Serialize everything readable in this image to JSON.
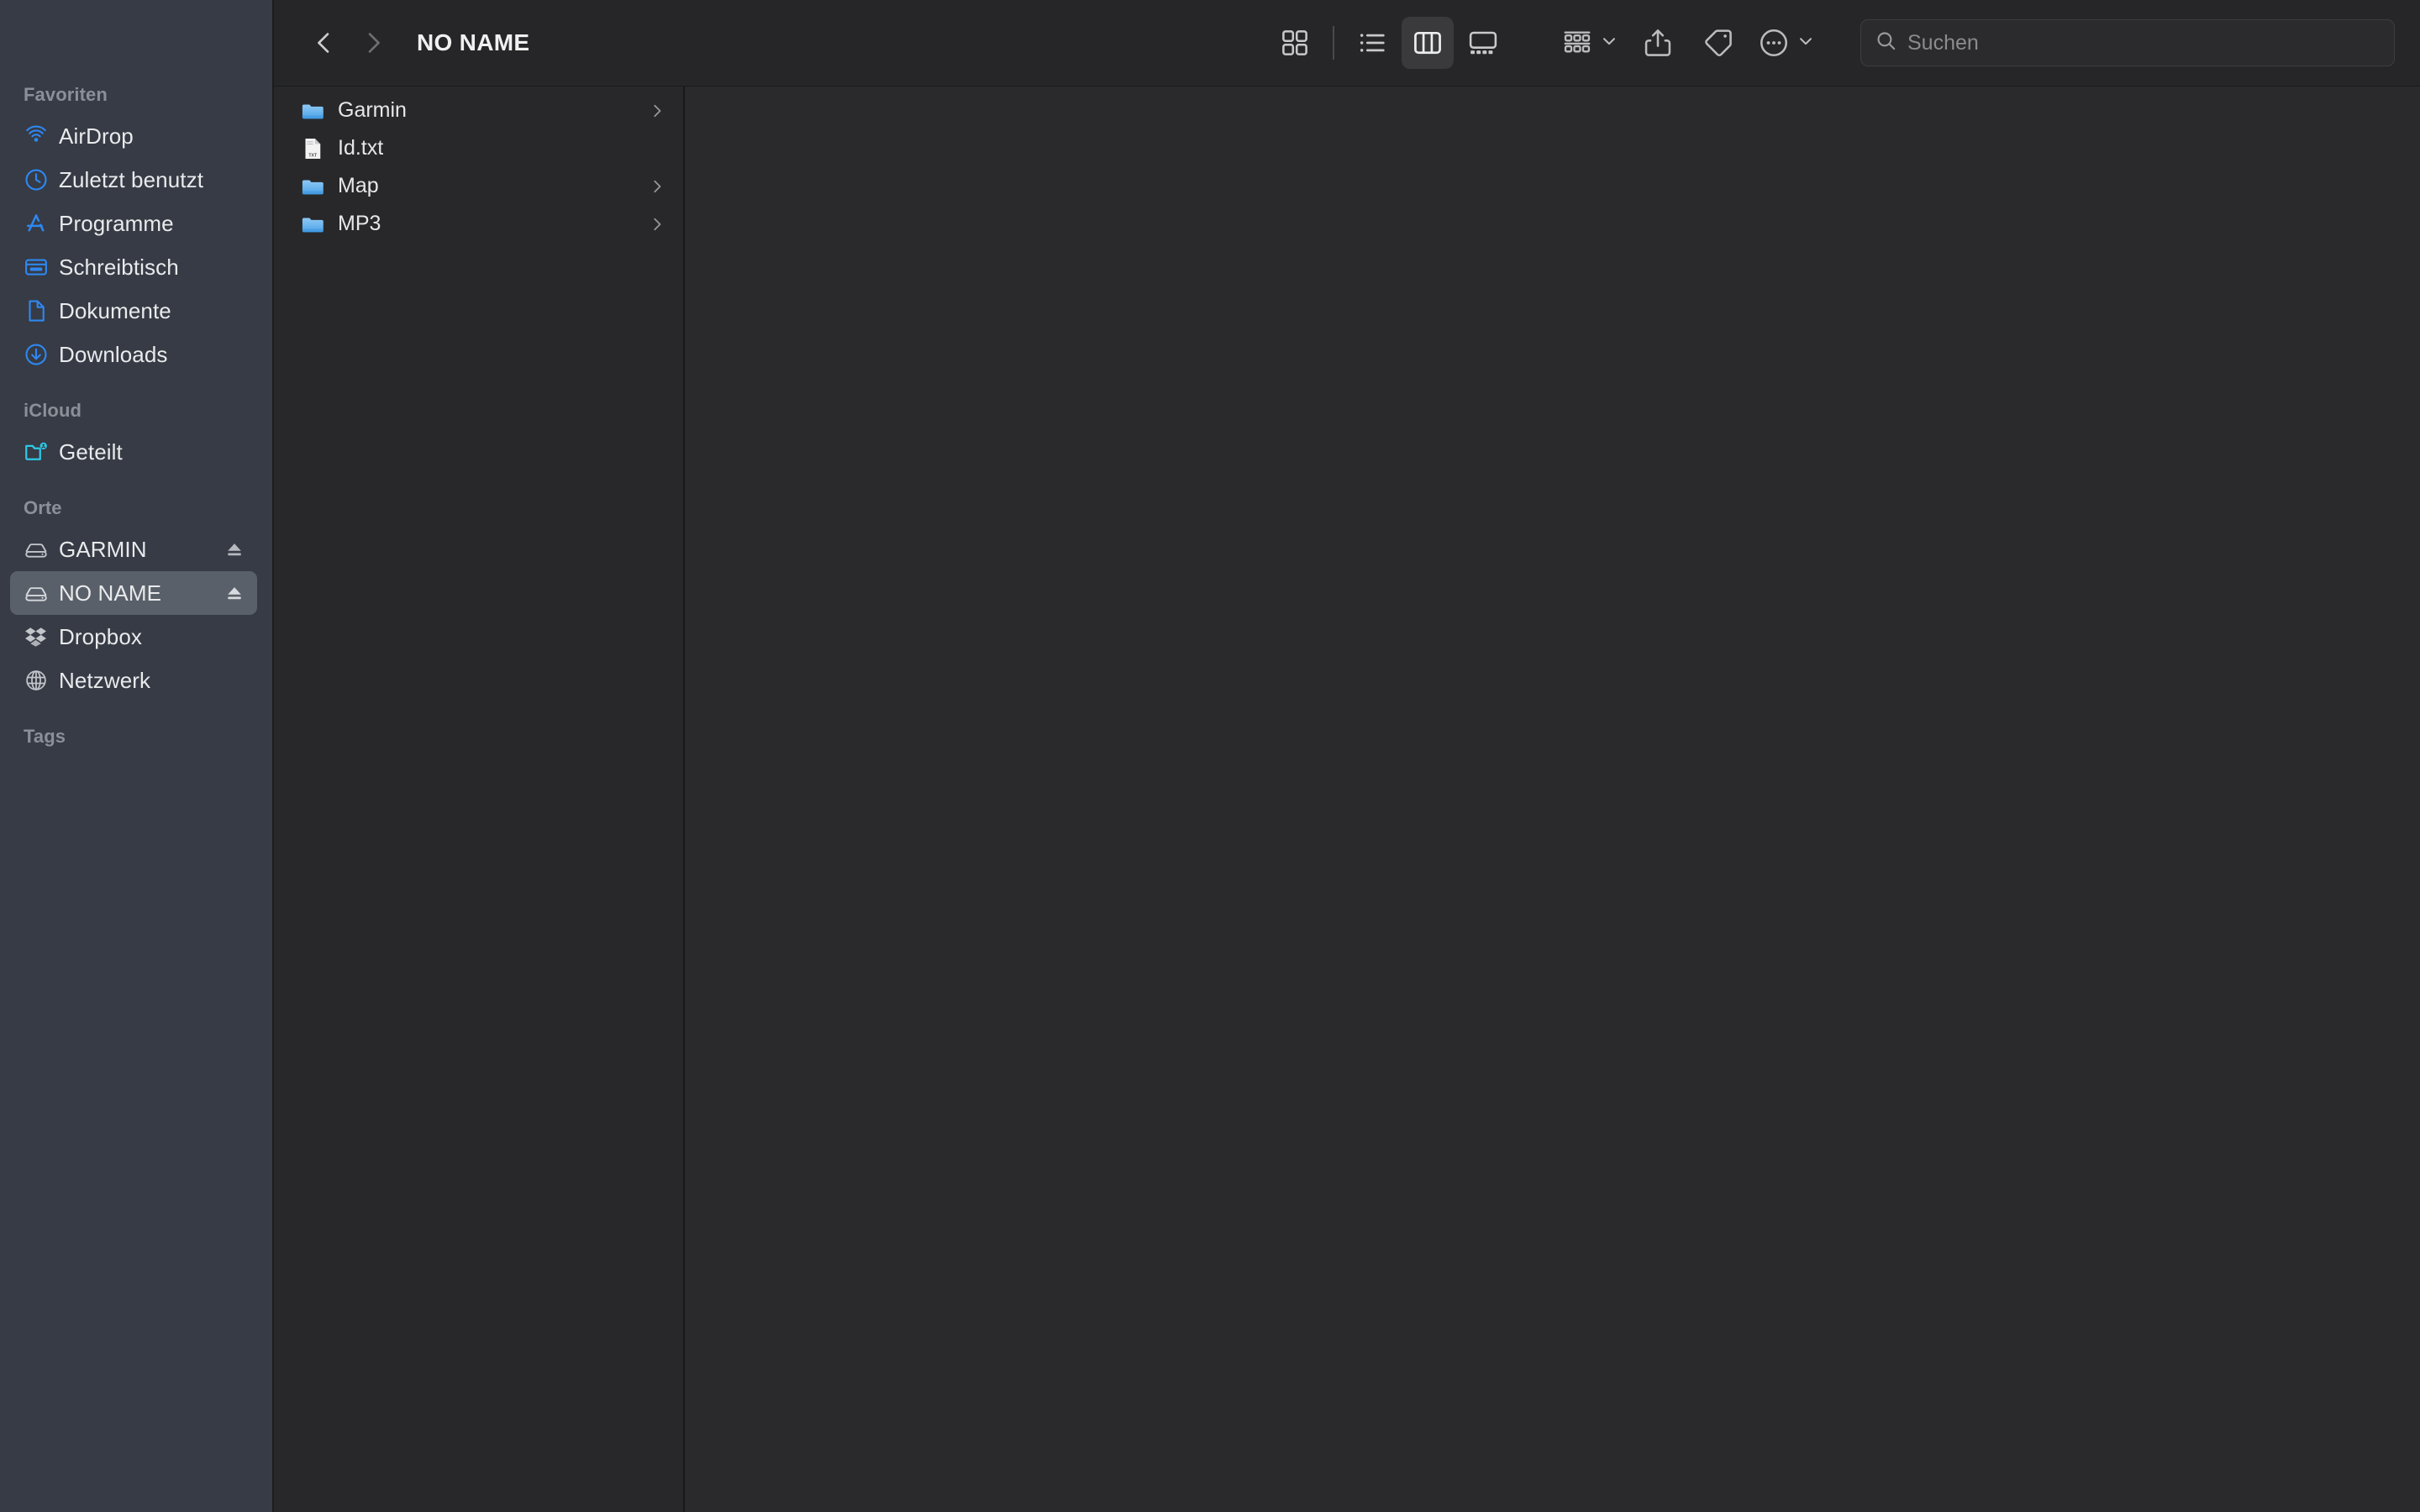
{
  "window": {
    "title": "NO NAME",
    "theme": "dark",
    "colors": {
      "sidebar_bg": "#363b45",
      "content_bg": "#28282a",
      "toolbar_bg": "#262628",
      "selection_bg": "#5a6069",
      "accent_blue": "#2f87f0",
      "folder_blue": "#6cb6ef",
      "icloud_cyan": "#2ec8e6",
      "text_primary": "#e9eaec",
      "text_secondary": "#8b8f97"
    }
  },
  "toolbar": {
    "back_label": "Zurück",
    "back_icon": "chevron-left-icon",
    "back_enabled": true,
    "forward_label": "Vorwärts",
    "forward_icon": "chevron-right-icon",
    "forward_enabled": false,
    "view_modes": [
      {
        "id": "icon",
        "label": "Symbole",
        "icon": "grid-view-icon",
        "active": false
      },
      {
        "id": "list",
        "label": "Liste",
        "icon": "list-view-icon",
        "active": false
      },
      {
        "id": "column",
        "label": "Spalten",
        "icon": "column-view-icon",
        "active": true
      },
      {
        "id": "gallery",
        "label": "Galerie",
        "icon": "gallery-view-icon",
        "active": false
      }
    ],
    "actions": [
      {
        "id": "group",
        "label": "Gruppieren",
        "icon": "group-by-icon",
        "has_chevron": true
      },
      {
        "id": "share",
        "label": "Teilen",
        "icon": "share-icon",
        "has_chevron": false
      },
      {
        "id": "tags",
        "label": "Tags",
        "icon": "tag-icon",
        "has_chevron": false
      },
      {
        "id": "more",
        "label": "Mehr",
        "icon": "ellipsis-circle-icon",
        "has_chevron": true
      }
    ]
  },
  "search": {
    "placeholder": "Suchen",
    "value": "",
    "icon": "search-icon"
  },
  "sidebar": {
    "groups": [
      {
        "title": "Favoriten",
        "items": [
          {
            "label": "AirDrop",
            "icon": "airdrop-icon",
            "selected": false,
            "ejectable": false
          },
          {
            "label": "Zuletzt benutzt",
            "icon": "clock-icon",
            "selected": false,
            "ejectable": false
          },
          {
            "label": "Programme",
            "icon": "applications-icon",
            "selected": false,
            "ejectable": false
          },
          {
            "label": "Schreibtisch",
            "icon": "desktop-icon",
            "selected": false,
            "ejectable": false
          },
          {
            "label": "Dokumente",
            "icon": "document-icon",
            "selected": false,
            "ejectable": false
          },
          {
            "label": "Downloads",
            "icon": "downloads-icon",
            "selected": false,
            "ejectable": false
          }
        ]
      },
      {
        "title": "iCloud",
        "items": [
          {
            "label": "Geteilt",
            "icon": "shared-folder-icon",
            "selected": false,
            "ejectable": false
          }
        ]
      },
      {
        "title": "Orte",
        "items": [
          {
            "label": "GARMIN",
            "icon": "external-drive-icon",
            "selected": false,
            "ejectable": true
          },
          {
            "label": "NO NAME",
            "icon": "external-drive-icon",
            "selected": true,
            "ejectable": true
          },
          {
            "label": "Dropbox",
            "icon": "dropbox-icon",
            "selected": false,
            "ejectable": false
          },
          {
            "label": "Netzwerk",
            "icon": "network-globe-icon",
            "selected": false,
            "ejectable": false
          }
        ]
      },
      {
        "title": "Tags",
        "items": []
      }
    ]
  },
  "file_browser": {
    "columns": [
      {
        "id": "no-name-root",
        "items": [
          {
            "name": "Garmin",
            "type": "folder",
            "icon": "folder-icon",
            "has_children": true
          },
          {
            "name": "Id.txt",
            "type": "file",
            "icon": "txt-file-icon",
            "has_children": false
          },
          {
            "name": "Map",
            "type": "folder",
            "icon": "folder-icon",
            "has_children": true
          },
          {
            "name": "MP3",
            "type": "folder",
            "icon": "folder-icon",
            "has_children": true
          }
        ]
      },
      {
        "id": "preview-column",
        "items": []
      }
    ]
  }
}
